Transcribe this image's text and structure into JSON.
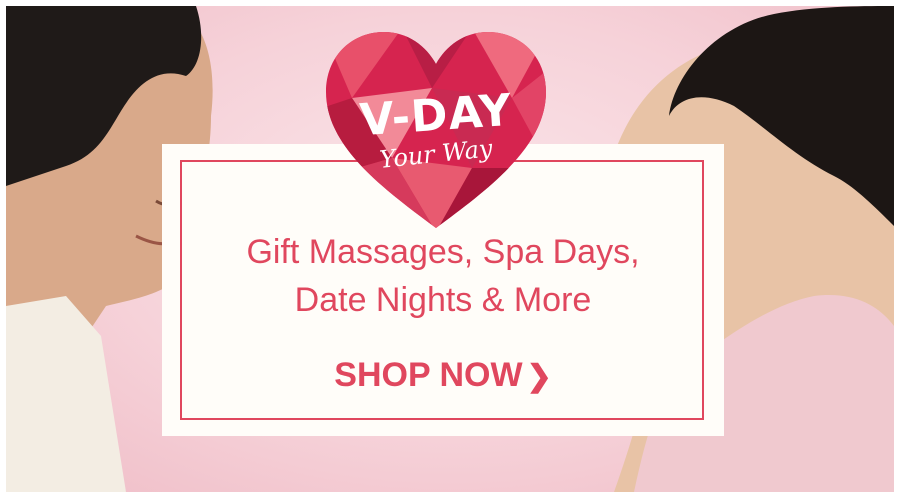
{
  "banner": {
    "heart_title": "V-DAY",
    "heart_subtitle": "Your Way",
    "headline_line1": "Gift Massages, Spa Days,",
    "headline_line2": "Date Nights & More",
    "cta_label": "SHOP NOW",
    "cta_icon": "chevron-right-icon",
    "colors": {
      "accent": "#e0475e",
      "background": "#f6d2d9",
      "card": "#fffdf9"
    }
  }
}
